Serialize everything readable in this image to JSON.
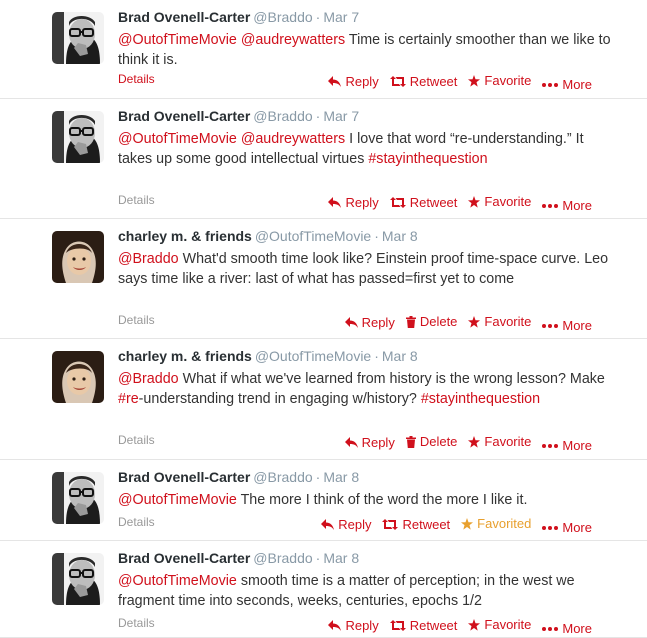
{
  "colors": {
    "accent": "#d0101c",
    "favorited": "#e8a02e",
    "muted": "#8899a6"
  },
  "tweets": [
    {
      "name": "Brad Ovenell-Carter",
      "handle": "@Braddo",
      "time": "Mar 7",
      "segments": [
        {
          "t": "@OutofTimeMovie",
          "l": true
        },
        {
          "t": " ",
          "l": false
        },
        {
          "t": "@audreywatters",
          "l": true
        },
        {
          "t": " Time is certainly smoother than we like to think it is.",
          "l": false
        }
      ],
      "details": "Details",
      "actions": {
        "reply": "Reply",
        "second": "Retweet",
        "second_type": "retweet",
        "favorite": "Favorite",
        "favorited": false,
        "more": "More"
      }
    },
    {
      "name": "Brad Ovenell-Carter",
      "handle": "@Braddo",
      "time": "Mar 7",
      "segments": [
        {
          "t": "@OutofTimeMovie",
          "l": true
        },
        {
          "t": " ",
          "l": false
        },
        {
          "t": "@audreywatters",
          "l": true
        },
        {
          "t": " I love that word “re-understanding.” It takes up some good intellectual virtues ",
          "l": false
        },
        {
          "t": "#stayinthequestion",
          "l": true
        }
      ],
      "details": "Details",
      "actions": {
        "reply": "Reply",
        "second": "Retweet",
        "second_type": "retweet",
        "favorite": "Favorite",
        "favorited": false,
        "more": "More"
      }
    },
    {
      "name": "charley m. & friends",
      "handle": "@OutofTimeMovie",
      "time": "Mar 8",
      "segments": [
        {
          "t": "@Braddo",
          "l": true
        },
        {
          "t": " What'd smooth time look like? Einstein proof time-space curve. Leo says time like a river: last of what has passed=first yet to come",
          "l": false
        }
      ],
      "details": "Details",
      "actions": {
        "reply": "Reply",
        "second": "Delete",
        "second_type": "delete",
        "favorite": "Favorite",
        "favorited": false,
        "more": "More"
      }
    },
    {
      "name": "charley m. & friends",
      "handle": "@OutofTimeMovie",
      "time": "Mar 8",
      "segments": [
        {
          "t": "@Braddo",
          "l": true
        },
        {
          "t": " What if what we've learned from history is the wrong lesson? Make ",
          "l": false
        },
        {
          "t": "#re",
          "l": true
        },
        {
          "t": "-understanding trend in engaging w/history? ",
          "l": false
        },
        {
          "t": "#stayinthequestion",
          "l": true
        }
      ],
      "details": "Details",
      "actions": {
        "reply": "Reply",
        "second": "Delete",
        "second_type": "delete",
        "favorite": "Favorite",
        "favorited": false,
        "more": "More"
      }
    },
    {
      "name": "Brad Ovenell-Carter",
      "handle": "@Braddo",
      "time": "Mar 8",
      "segments": [
        {
          "t": "@OutofTimeMovie",
          "l": true
        },
        {
          "t": " The more I think of the word the more I like it.",
          "l": false
        }
      ],
      "details": "Details",
      "actions": {
        "reply": "Reply",
        "second": "Retweet",
        "second_type": "retweet",
        "favorite": "Favorited",
        "favorited": true,
        "more": "More"
      }
    },
    {
      "name": "Brad Ovenell-Carter",
      "handle": "@Braddo",
      "time": "Mar 8",
      "segments": [
        {
          "t": "@OutofTimeMovie",
          "l": true
        },
        {
          "t": " smooth time is a matter of perception; in the west we fragment time into seconds, weeks, centuries, epochs 1/2",
          "l": false
        }
      ],
      "details": "Details",
      "actions": {
        "reply": "Reply",
        "second": "Retweet",
        "second_type": "retweet",
        "favorite": "Favorite",
        "favorited": false,
        "more": "More"
      }
    }
  ]
}
